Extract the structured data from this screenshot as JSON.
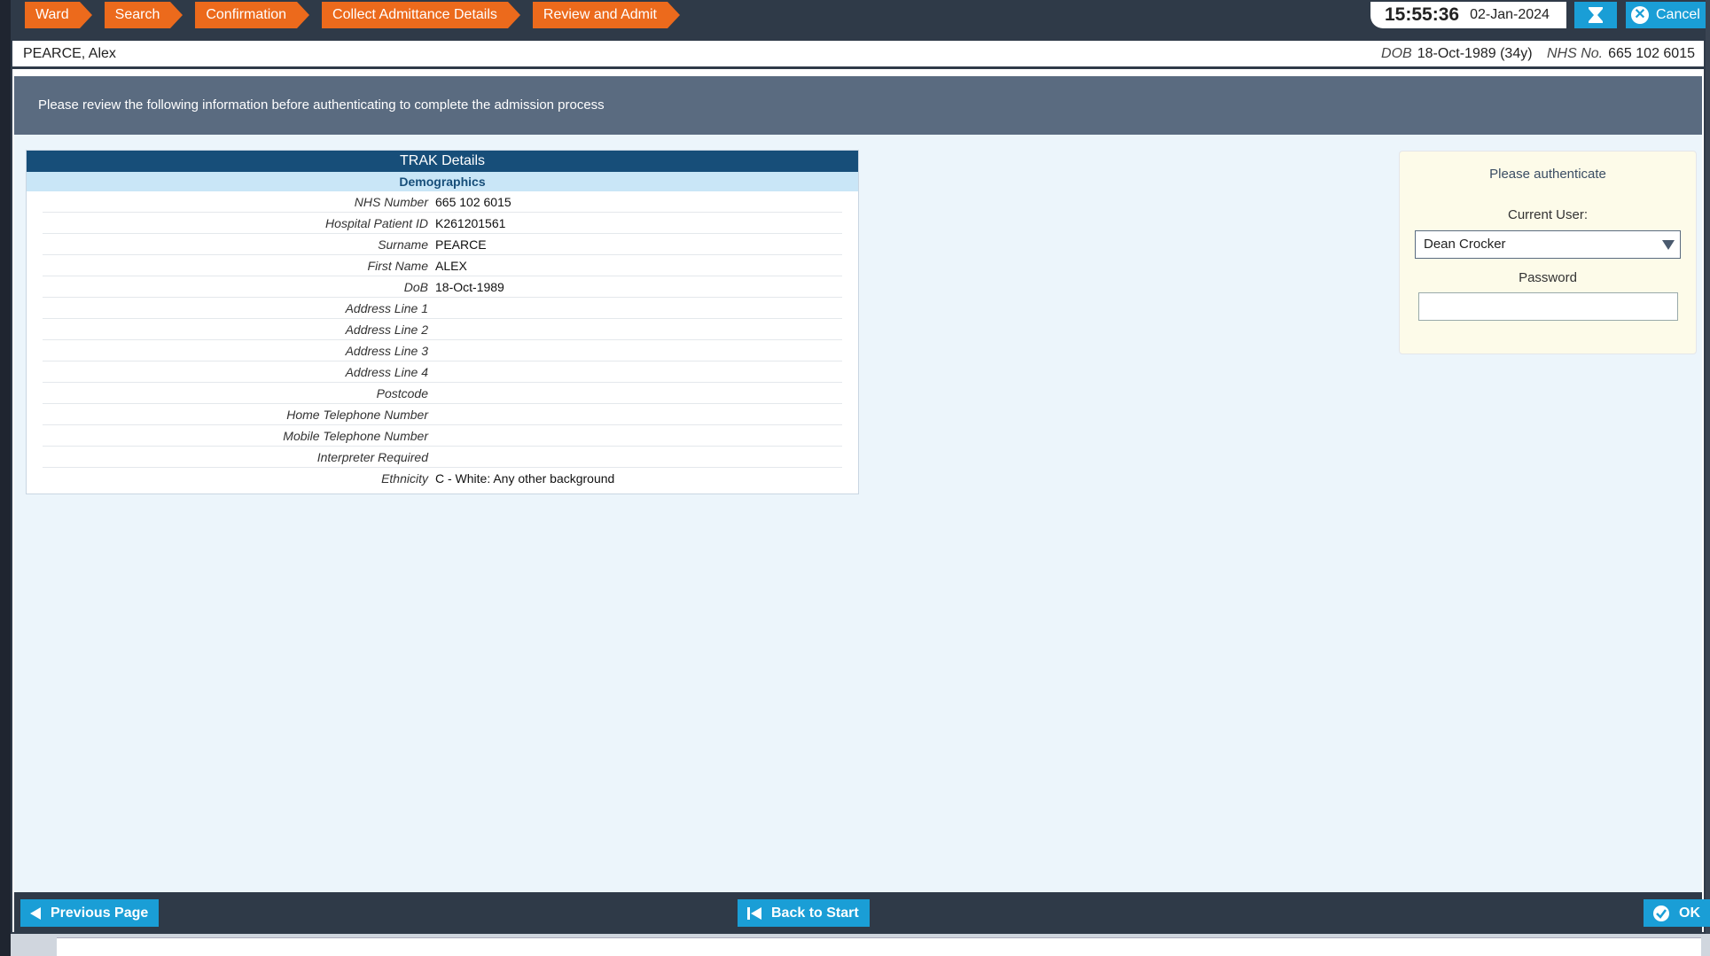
{
  "breadcrumbs": [
    "Ward",
    "Search",
    "Confirmation",
    "Collect Admittance Details",
    "Review and Admit"
  ],
  "clock": {
    "time": "15:55:36",
    "date": "02-Jan-2024"
  },
  "header": {
    "cancel_label": "Cancel"
  },
  "patient": {
    "name": "PEARCE, Alex",
    "dob_label": "DOB",
    "dob_value": "18-Oct-1989 (34y)",
    "nhs_label": "NHS No.",
    "nhs_value": "665 102 6015"
  },
  "info_message": "Please review the following information before authenticating to complete the admission process",
  "trak": {
    "title": "TRAK Details",
    "section": "Demographics",
    "rows": [
      {
        "label": "NHS Number",
        "value": "665 102 6015"
      },
      {
        "label": "Hospital Patient ID",
        "value": "K261201561"
      },
      {
        "label": "Surname",
        "value": "PEARCE"
      },
      {
        "label": "First Name",
        "value": "ALEX"
      },
      {
        "label": "DoB",
        "value": "18-Oct-1989"
      },
      {
        "label": "Address Line 1",
        "value": ""
      },
      {
        "label": "Address Line 2",
        "value": ""
      },
      {
        "label": "Address Line 3",
        "value": ""
      },
      {
        "label": "Address Line 4",
        "value": ""
      },
      {
        "label": "Postcode",
        "value": ""
      },
      {
        "label": "Home Telephone Number",
        "value": ""
      },
      {
        "label": "Mobile Telephone Number",
        "value": ""
      },
      {
        "label": "Interpreter Required",
        "value": ""
      },
      {
        "label": "Ethnicity",
        "value": "C - White: Any other background"
      }
    ]
  },
  "auth": {
    "heading": "Please authenticate",
    "current_user_label": "Current User:",
    "current_user_value": "Dean Crocker",
    "password_label": "Password",
    "password_value": ""
  },
  "footer": {
    "previous_label": "Previous Page",
    "back_label": "Back to Start",
    "ok_label": "OK"
  },
  "colors": {
    "breadcrumb": "#ec6a1c",
    "accent": "#1a9ed6",
    "dark_bar": "#2f3a48",
    "panel_header": "#174e79"
  }
}
